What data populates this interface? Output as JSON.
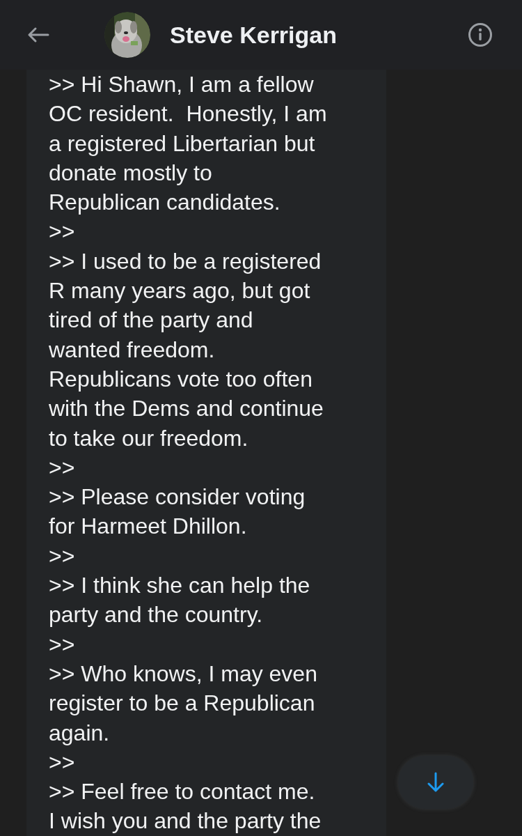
{
  "header": {
    "name": "Steve Kerrigan"
  },
  "message": {
    "lines": [
      ">> Hi Shawn, I am a fellow",
      "OC resident.  Honestly, I am",
      "a registered Libertarian but",
      "donate mostly to",
      "Republican candidates.",
      ">>",
      ">> I used to be a registered",
      "R many years ago, but got",
      "tired of the party and",
      "wanted freedom.",
      "Republicans vote too often",
      "with the Dems and continue",
      "to take our freedom.",
      ">>",
      ">> Please consider voting",
      "for Harmeet Dhillon.",
      ">>",
      ">> I think she can help the",
      "party and the country.",
      ">>",
      ">> Who knows, I may even",
      "register to be a Republican",
      "again.",
      ">>",
      ">> Feel free to contact me.",
      "I wish you and the party the"
    ]
  }
}
